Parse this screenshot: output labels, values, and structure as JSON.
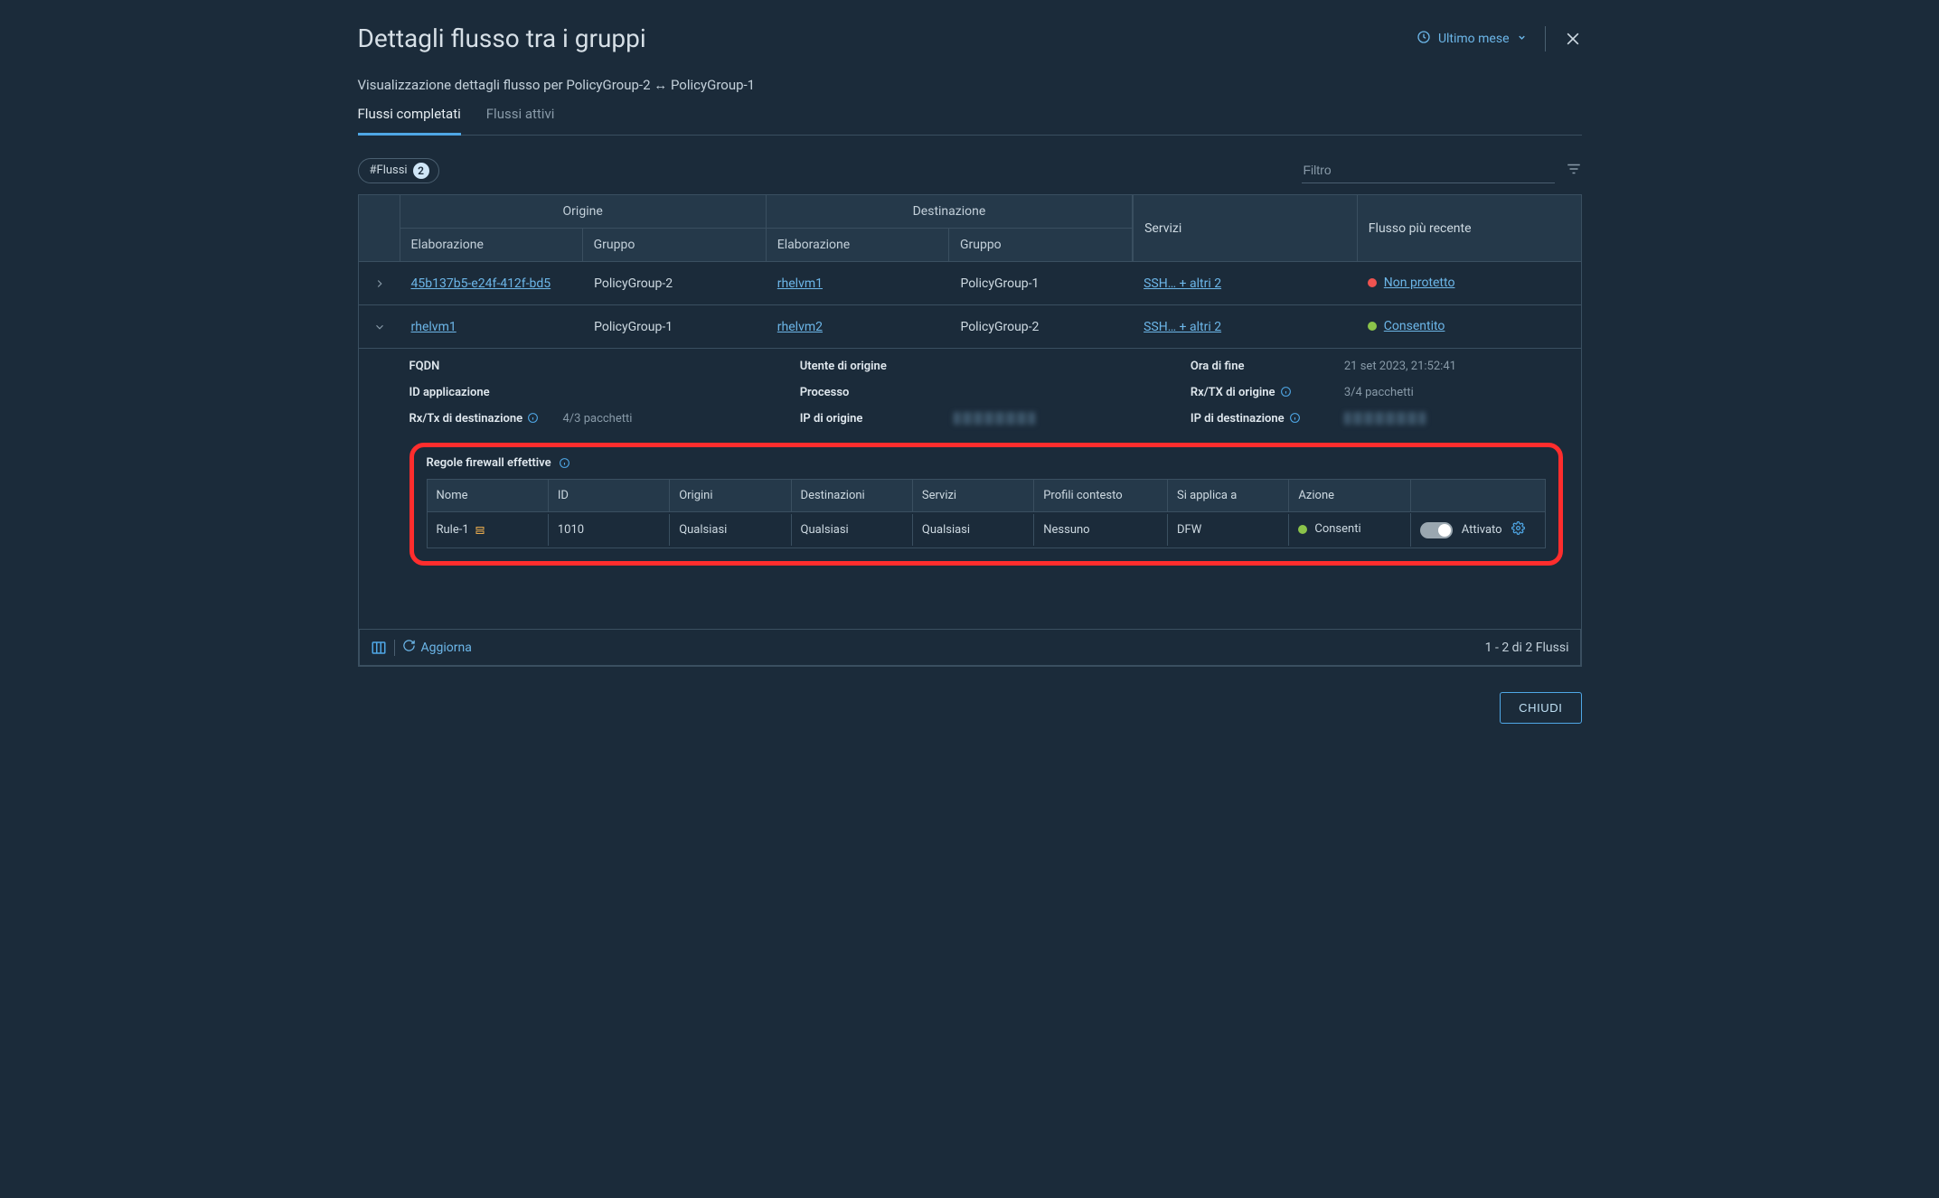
{
  "header": {
    "title": "Dettagli flusso tra i gruppi",
    "time_range_label": "Ultimo mese"
  },
  "subhead": "Visualizzazione dettagli flusso per PolicyGroup-2 ↔ PolicyGroup-1",
  "tabs": {
    "completed": "Flussi completati",
    "active": "Flussi attivi"
  },
  "chip": {
    "label": "#Flussi",
    "count": "2"
  },
  "filter": {
    "placeholder": "Filtro"
  },
  "columns": {
    "origin_group": "Origine",
    "dest_group": "Destinazione",
    "processing": "Elaborazione",
    "group": "Gruppo",
    "services": "Servizi",
    "latest_flow": "Flusso più recente"
  },
  "rows": [
    {
      "expanded": false,
      "origin_proc": "45b137b5-e24f-412f-bd5",
      "origin_group": "PolicyGroup-2",
      "dest_proc": "rhelvm1",
      "dest_group": "PolicyGroup-1",
      "services": "SSH… + altri 2",
      "status_color": "red",
      "status_label": "Non protetto"
    },
    {
      "expanded": true,
      "origin_proc": "rhelvm1",
      "origin_group": "PolicyGroup-1",
      "dest_proc": "rhelvm2",
      "dest_group": "PolicyGroup-2",
      "services": "SSH… + altri 2",
      "status_color": "green",
      "status_label": "Consentito"
    }
  ],
  "details": {
    "labels": {
      "fqdn": "FQDN",
      "app_id": "ID applicazione",
      "rx_tx_dest": "Rx/Tx di destinazione",
      "src_user": "Utente di origine",
      "process": "Processo",
      "src_ip": "IP di origine",
      "end_time": "Ora di fine",
      "rx_tx_src": "Rx/TX di origine",
      "dest_ip": "IP di destinazione"
    },
    "values": {
      "end_time": "21 set 2023, 21:52:41",
      "rx_tx_src": "3/4 pacchetti",
      "rx_tx_dest": "4/3 pacchetti"
    }
  },
  "firewall": {
    "section_title": "Regole firewall effettive",
    "columns": {
      "name": "Nome",
      "id": "ID",
      "origins": "Origini",
      "destinations": "Destinazioni",
      "services": "Servizi",
      "context": "Profili contesto",
      "applies_to": "Si applica a",
      "action": "Azione"
    },
    "row": {
      "name": "Rule-1",
      "id": "1010",
      "origins": "Qualsiasi",
      "destinations": "Qualsiasi",
      "services": "Qualsiasi",
      "context": "Nessuno",
      "applies_to": "DFW",
      "action": "Consenti",
      "toggle_label": "Attivato"
    }
  },
  "footer": {
    "refresh": "Aggiorna",
    "pager": "1 - 2 di 2 Flussi",
    "close": "CHIUDI"
  }
}
